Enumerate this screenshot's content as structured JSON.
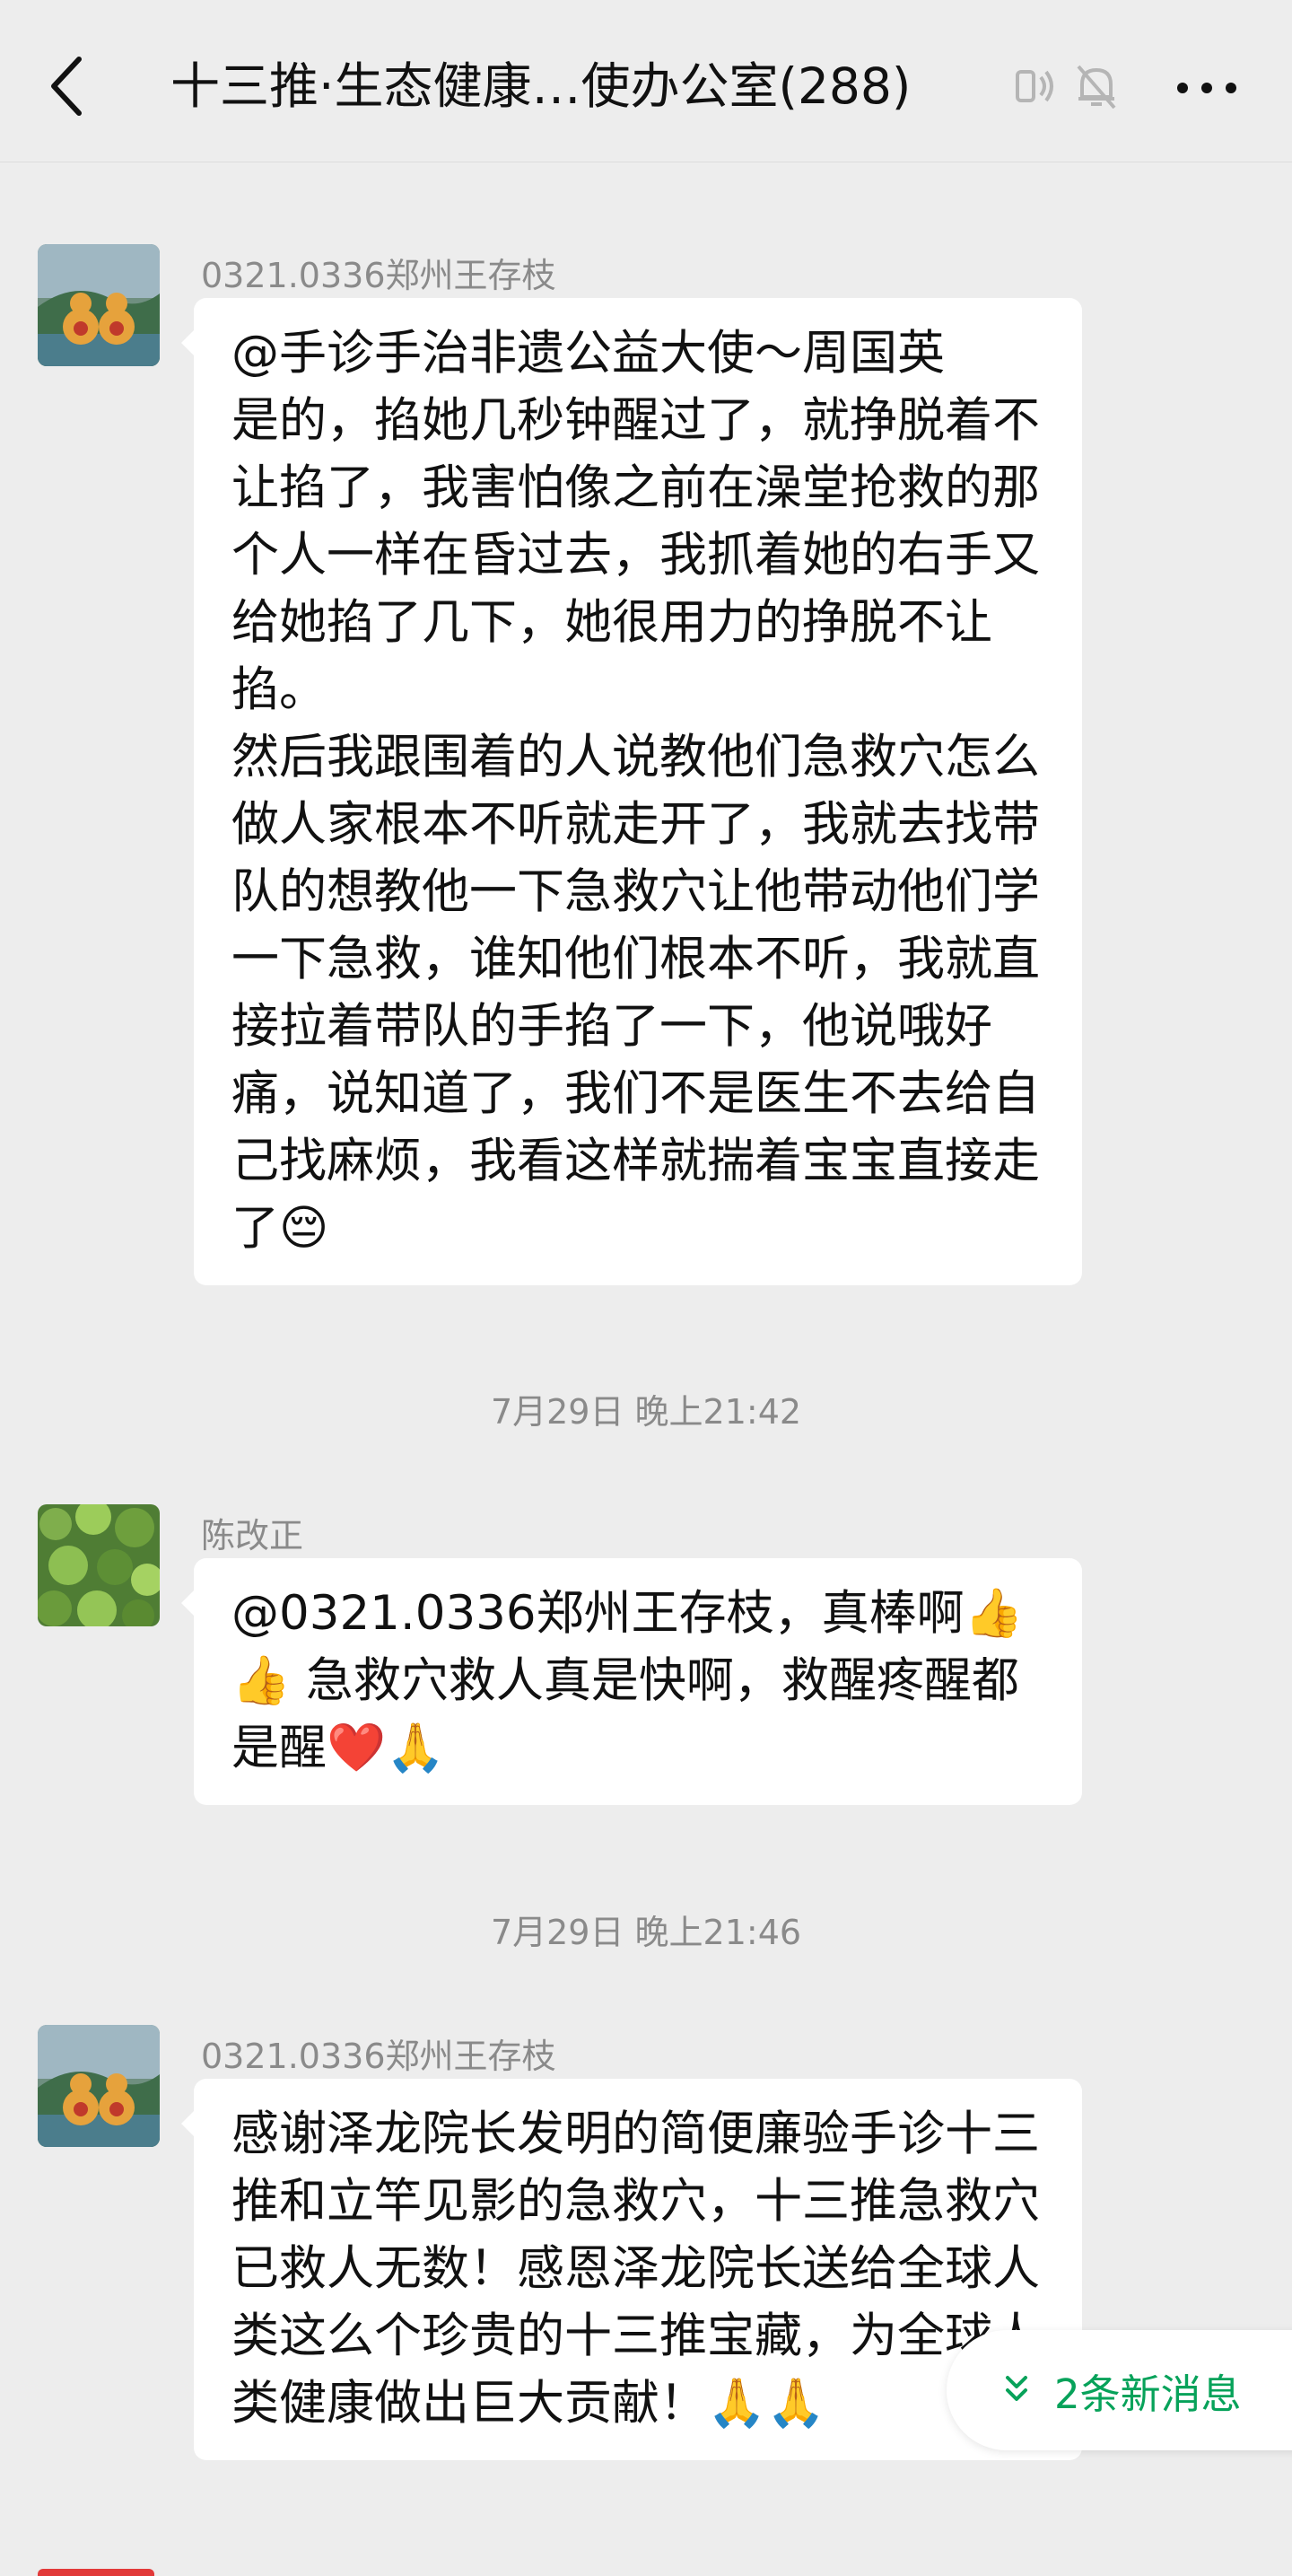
{
  "header": {
    "title": "十三推·生态健康…使办公室(288)",
    "back_icon": "chevron-left-icon",
    "voice_icon": "speaker-icon",
    "mute_icon": "bell-muted-icon",
    "more_icon": "more-dots-icon"
  },
  "messages": [
    {
      "sender": "0321.0336郑州王存枝",
      "text": "@手诊手治非遗公益大使～周国英\n是的，掐她几秒钟醒过了，就挣脱着不让掐了，我害怕像之前在澡堂抢救的那个人一样在昏过去，我抓着她的右手又给她掐了几下，她很用力的挣脱不让掐。\n然后我跟围着的人说教他们急救穴怎么做人家根本不听就走开了，我就去找带队的想教他一下急救穴让他带动他们学一下急救，谁知他们根本不听，我就直接拉着带队的手掐了一下，他说哦好痛，说知道了，我们不是医生不去给自己找麻烦，我看这样就揣着宝宝直接走了😔"
    },
    {
      "timestamp": "7月29日 晚上21:42",
      "sender": "陈改正",
      "text": "@0321.0336郑州王存枝，真棒啊👍👍 急救穴救人真是快啊，救醒疼醒都是醒❤️🙏"
    },
    {
      "timestamp": "7月29日 晚上21:46",
      "sender": "0321.0336郑州王存枝",
      "text": "感谢泽龙院长发明的简便廉验手诊十三推和立竿见影的急救穴，十三推急救穴已救人无数！感恩泽龙院长送给全球人类这么个珍贵的十三推宝藏，为全球人类健康做出巨大贡献！🙏🙏"
    }
  ],
  "new_messages_label": "2条新消息",
  "colors": {
    "background": "#ededed",
    "bubble": "#ffffff",
    "accent_green": "#07a25a"
  }
}
